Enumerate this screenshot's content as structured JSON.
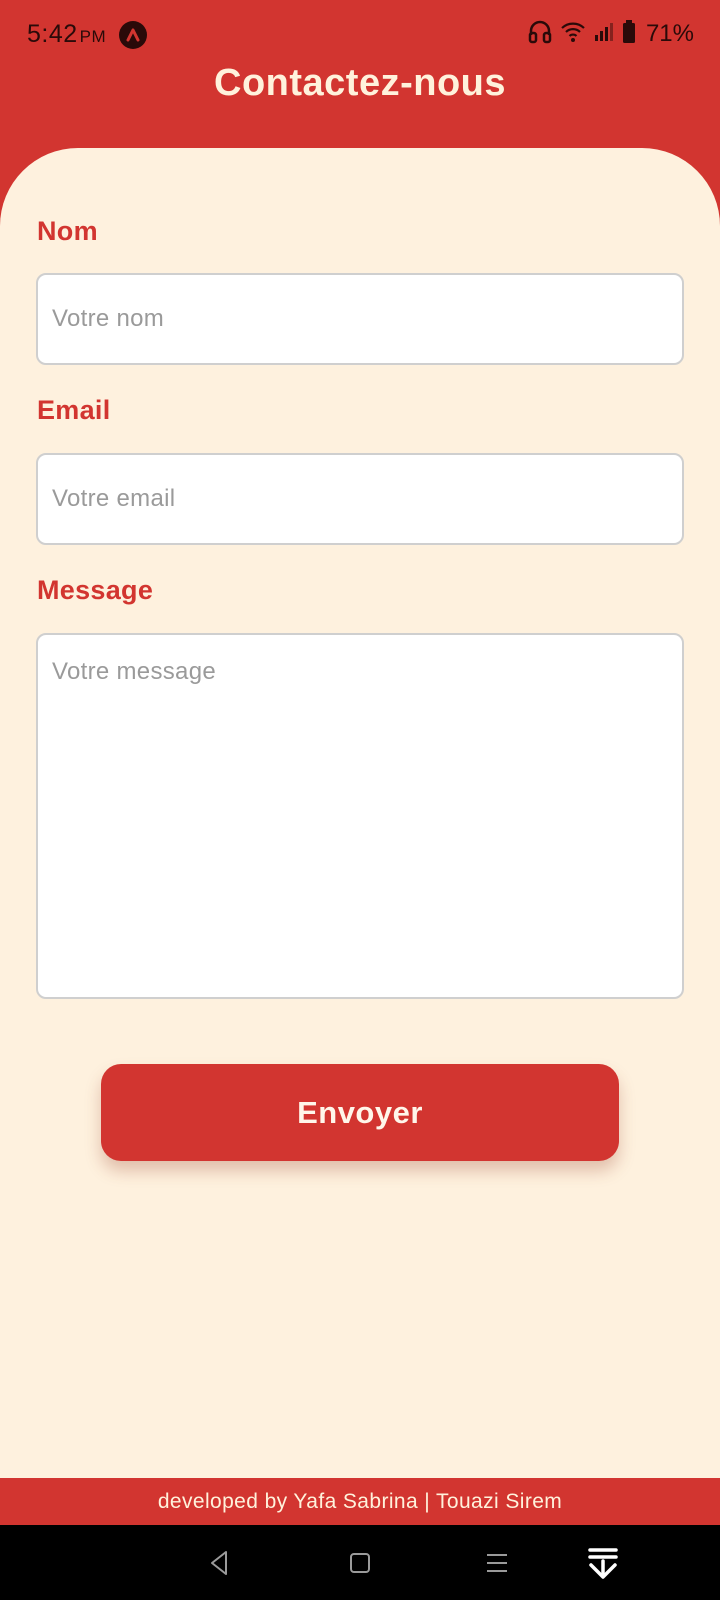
{
  "status_bar": {
    "time": "5:42",
    "ampm": "PM",
    "battery": "71%",
    "icons": [
      "app-notification-icon",
      "headphones-icon",
      "wifi-icon",
      "cell-signal-icon",
      "battery-icon"
    ]
  },
  "header": {
    "title": "Contactez-nous"
  },
  "form": {
    "name_label": "Nom",
    "name_placeholder": "Votre nom",
    "email_label": "Email",
    "email_placeholder": "Votre email",
    "message_label": "Message",
    "message_placeholder": "Votre message",
    "submit_label": "Envoyer"
  },
  "footer": {
    "text": "developed by Yafa Sabrina | Touazi Sirem"
  },
  "nav_bar": {
    "icons": [
      "back-icon",
      "home-icon",
      "recents-icon",
      "download-icon"
    ]
  },
  "colors": {
    "primary": "#D23530",
    "background": "#FEF1DE",
    "title_text": "#FFF2DC",
    "field_border": "#CFCFCF",
    "placeholder": "#9A9A9A"
  }
}
